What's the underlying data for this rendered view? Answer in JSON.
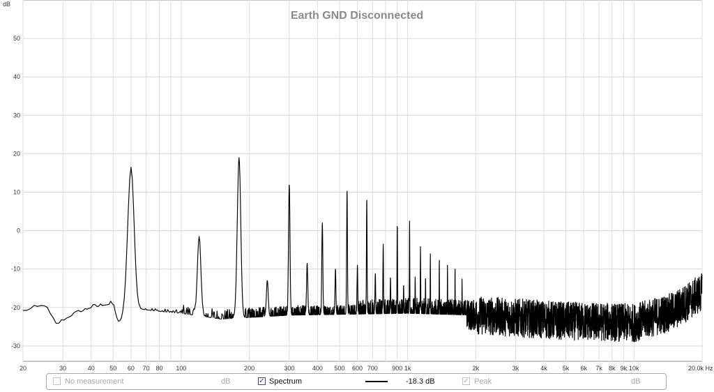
{
  "chart_data": {
    "type": "line",
    "title": "Earth GND Disconnected",
    "ylabel": "dB",
    "xlabel": "",
    "x_scale": "log",
    "xlim": [
      20,
      20000
    ],
    "ylim": [
      -34,
      60
    ],
    "grid": true,
    "x_unit": "Hz",
    "x_ticks": [
      {
        "v": 20,
        "label": "20"
      },
      {
        "v": 30,
        "label": "30"
      },
      {
        "v": 40,
        "label": "40"
      },
      {
        "v": 50,
        "label": "50"
      },
      {
        "v": 60,
        "label": "60"
      },
      {
        "v": 70,
        "label": "70"
      },
      {
        "v": 80,
        "label": "80"
      },
      {
        "v": 100,
        "label": "100"
      },
      {
        "v": 200,
        "label": "200"
      },
      {
        "v": 300,
        "label": "300"
      },
      {
        "v": 400,
        "label": "400"
      },
      {
        "v": 500,
        "label": "500"
      },
      {
        "v": 600,
        "label": "600"
      },
      {
        "v": 700,
        "label": "700"
      },
      {
        "v": 900,
        "label": "900"
      },
      {
        "v": 1000,
        "label": "1k"
      },
      {
        "v": 2000,
        "label": "2k"
      },
      {
        "v": 3000,
        "label": "3k"
      },
      {
        "v": 4000,
        "label": "4k"
      },
      {
        "v": 5000,
        "label": "5k"
      },
      {
        "v": 6000,
        "label": "6k"
      },
      {
        "v": 7000,
        "label": "7k"
      },
      {
        "v": 8000,
        "label": "8k"
      },
      {
        "v": 9000,
        "label": "9k"
      },
      {
        "v": 10000,
        "label": "10k"
      },
      {
        "v": 20000,
        "label": "20.0k Hz"
      }
    ],
    "y_ticks": [
      50,
      40,
      30,
      20,
      10,
      0,
      -10,
      -20,
      -30
    ],
    "series": [
      {
        "name": "Spectrum",
        "color": "#000000",
        "peaks": [
          {
            "hz": 60,
            "db": 16.5
          },
          {
            "hz": 120,
            "db": -1.5
          },
          {
            "hz": 180,
            "db": 19
          },
          {
            "hz": 240,
            "db": -13
          },
          {
            "hz": 300,
            "db": 12
          },
          {
            "hz": 360,
            "db": -8.5
          },
          {
            "hz": 420,
            "db": 2
          },
          {
            "hz": 480,
            "db": -10
          },
          {
            "hz": 540,
            "db": 10.5
          },
          {
            "hz": 600,
            "db": -9
          },
          {
            "hz": 660,
            "db": 8.5
          },
          {
            "hz": 720,
            "db": -11
          },
          {
            "hz": 780,
            "db": -3.5
          },
          {
            "hz": 840,
            "db": -12
          },
          {
            "hz": 900,
            "db": 2
          },
          {
            "hz": 960,
            "db": -14
          },
          {
            "hz": 1020,
            "db": 2.5
          },
          {
            "hz": 1080,
            "db": -12
          },
          {
            "hz": 1140,
            "db": -4
          },
          {
            "hz": 1200,
            "db": -12
          },
          {
            "hz": 1260,
            "db": -6
          },
          {
            "hz": 1380,
            "db": -7
          },
          {
            "hz": 1500,
            "db": -8.5
          },
          {
            "hz": 1620,
            "db": -9
          },
          {
            "hz": 1740,
            "db": -12
          }
        ],
        "baseline": [
          {
            "hz": 20,
            "db": -21
          },
          {
            "hz": 25,
            "db": -19.5
          },
          {
            "hz": 28,
            "db": -24.5
          },
          {
            "hz": 33,
            "db": -22
          },
          {
            "hz": 40,
            "db": -20
          },
          {
            "hz": 50,
            "db": -19
          },
          {
            "hz": 53,
            "db": -24.5
          },
          {
            "hz": 58,
            "db": -20
          },
          {
            "hz": 80,
            "db": -21
          },
          {
            "hz": 100,
            "db": -21.5
          },
          {
            "hz": 150,
            "db": -23
          },
          {
            "hz": 300,
            "db": -22
          },
          {
            "hz": 1000,
            "db": -21.5
          },
          {
            "hz": 2000,
            "db": -22
          },
          {
            "hz": 5000,
            "db": -23.5
          },
          {
            "hz": 10000,
            "db": -24
          },
          {
            "hz": 15000,
            "db": -21
          },
          {
            "hz": 20000,
            "db": -16
          }
        ]
      }
    ]
  },
  "legend": {
    "no_measurement": {
      "label": "No measurement",
      "unit": "dB",
      "checked": false
    },
    "spectrum": {
      "label": "Spectrum",
      "value": "-18.3 dB",
      "checked": true
    },
    "peak": {
      "label": "Peak",
      "unit": "dB",
      "checked": true
    }
  }
}
